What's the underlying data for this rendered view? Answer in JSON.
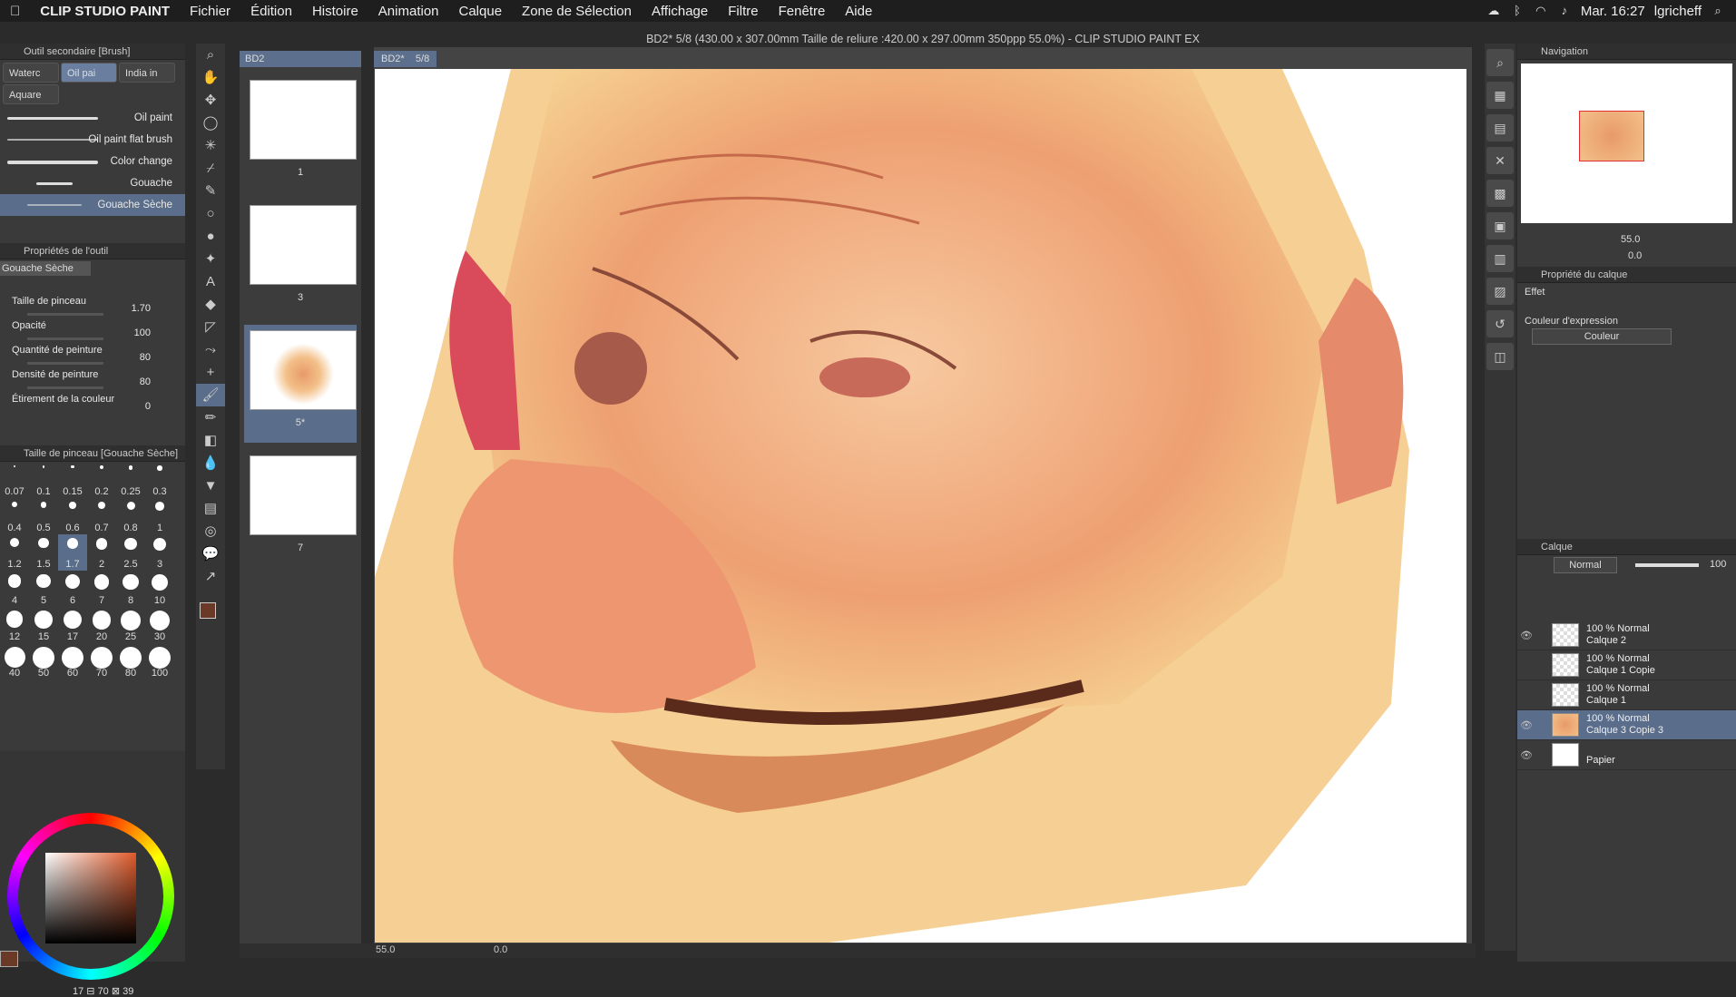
{
  "menubar": {
    "app": "CLIP STUDIO PAINT",
    "items": [
      "Fichier",
      "Édition",
      "Histoire",
      "Animation",
      "Calque",
      "Zone de Sélection",
      "Affichage",
      "Filtre",
      "Fenêtre",
      "Aide"
    ],
    "clock": "Mar. 16:27",
    "user": "lgricheff"
  },
  "window": {
    "title": "BD2* 5/8 (430.00 x 307.00mm Taille de reliure :420.00 x 297.00mm 350ppp 55.0%)  - CLIP STUDIO PAINT EX"
  },
  "subtool": {
    "title": "Outil secondaire [Brush]",
    "tabs": [
      "Waterc",
      "Oil pai",
      "India in",
      "Aquare"
    ],
    "brushes": [
      "Oil paint",
      "Oil paint flat brush",
      "Color change",
      "Gouache",
      "Gouache Sèche"
    ]
  },
  "toolprops": {
    "title": "Propriétés de l'outil",
    "name": "Gouache Sèche",
    "rows": [
      {
        "label": "Taille de pinceau",
        "value": "1.70"
      },
      {
        "label": "Opacité",
        "value": "100"
      },
      {
        "label": "Quantité de peinture",
        "value": "80"
      },
      {
        "label": "Densité de peinture",
        "value": "80"
      },
      {
        "label": "Étirement de la couleur",
        "value": "0"
      }
    ]
  },
  "brushsize": {
    "title": "Taille de pinceau [Gouache Sèche]",
    "sizes": [
      "0.07",
      "0.1",
      "0.15",
      "0.2",
      "0.25",
      "0.3",
      "0.4",
      "0.5",
      "0.6",
      "0.7",
      "0.8",
      "1",
      "1.2",
      "1.5",
      "1.7",
      "2",
      "2.5",
      "3",
      "4",
      "5",
      "6",
      "7",
      "8",
      "10",
      "12",
      "15",
      "17",
      "20",
      "25",
      "30",
      "40",
      "50",
      "60",
      "70",
      "80",
      "100"
    ],
    "selected": "1.7"
  },
  "color": {
    "main": "#6b3a26",
    "sub": "#ffffff",
    "readout": "17 ⊟ 70 ⊠ 39"
  },
  "pages": {
    "tab": "BD2",
    "doc_tab": "BD2*",
    "doc_page": "5/8",
    "thumbs": [
      {
        "num": "1"
      },
      {
        "num": "3"
      },
      {
        "num": "5*"
      },
      {
        "num": "7"
      }
    ]
  },
  "status": {
    "zoom": "55.0",
    "angle": "0.0"
  },
  "navigator": {
    "title": "Navigation",
    "zoom": "55.0",
    "rotation": "0.0"
  },
  "layerprop": {
    "title": "Propriété du calque",
    "effect": "Effet",
    "expr_label": "Couleur d'expression",
    "expr_value": "Couleur"
  },
  "layers": {
    "title": "Calque",
    "blend": "Normal",
    "opacity": "100",
    "items": [
      {
        "mode": "100 % Normal",
        "name": "Calque 2"
      },
      {
        "mode": "100 % Normal",
        "name": "Calque 1 Copie"
      },
      {
        "mode": "100 % Normal",
        "name": "Calque 1"
      },
      {
        "mode": "100 % Normal",
        "name": "Calque 3 Copie 3"
      },
      {
        "mode": "",
        "name": "Papier"
      }
    ]
  }
}
